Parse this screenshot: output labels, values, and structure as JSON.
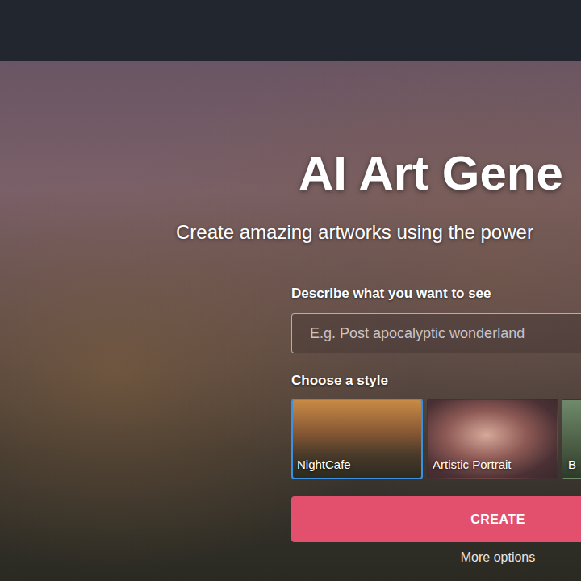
{
  "page": {
    "title": "AI Art Gene",
    "subtitle": "Create amazing artworks using the power"
  },
  "prompt": {
    "label": "Describe what you want to see",
    "placeholder": "E.g. Post apocalyptic wonderland"
  },
  "style_picker": {
    "label": "Choose a style",
    "styles": [
      {
        "label": "NightCafe",
        "selected": true
      },
      {
        "label": "Artistic Portrait",
        "selected": false
      },
      {
        "label": "B",
        "selected": false
      }
    ]
  },
  "create_button": "CREATE",
  "more_options": "More options"
}
